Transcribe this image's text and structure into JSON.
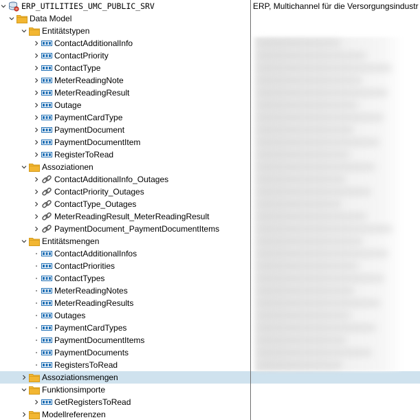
{
  "tree": {
    "root": {
      "label": "ERP_UTILITIES_UMC_PUBLIC_SRV",
      "description": "ERP, Multichannel für die Versorgungsindustr"
    },
    "data_model": {
      "label": "Data Model"
    },
    "entity_types": {
      "label": "Entitätstypen",
      "items": [
        "ContactAdditionalInfo",
        "ContactPriority",
        "ContactType",
        "MeterReadingNote",
        "MeterReadingResult",
        "Outage",
        "PaymentCardType",
        "PaymentDocument",
        "PaymentDocumentItem",
        "RegisterToRead"
      ]
    },
    "associations": {
      "label": "Assoziationen",
      "items": [
        "ContactAdditionalInfo_Outages",
        "ContactPriority_Outages",
        "ContactType_Outages",
        "MeterReadingResult_MeterReadingResult",
        "PaymentDocument_PaymentDocumentItems"
      ]
    },
    "entity_sets": {
      "label": "Entitätsmengen",
      "items": [
        "ContactAdditionalInfos",
        "ContactPriorities",
        "ContactTypes",
        "MeterReadingNotes",
        "MeterReadingResults",
        "Outages",
        "PaymentCardTypes",
        "PaymentDocumentItems",
        "PaymentDocuments",
        "RegistersToRead"
      ]
    },
    "association_sets": {
      "label": "Assoziationsmengen"
    },
    "function_imports": {
      "label": "Funktionsimporte",
      "items": [
        "GetRegistersToRead"
      ]
    },
    "model_references": {
      "label": "Modellreferenzen"
    }
  },
  "colors": {
    "folder": "#f2b632",
    "folder_dark": "#d39a1b",
    "entity_icon": "#1f6fb5",
    "selected_row": "#cfe2ee"
  },
  "icons": {
    "root": "service-database-icon",
    "folder": "folder-icon",
    "entity": "entity-type-icon",
    "association": "link-icon",
    "expand": "chevron-right-icon",
    "collapse": "chevron-down-icon"
  }
}
